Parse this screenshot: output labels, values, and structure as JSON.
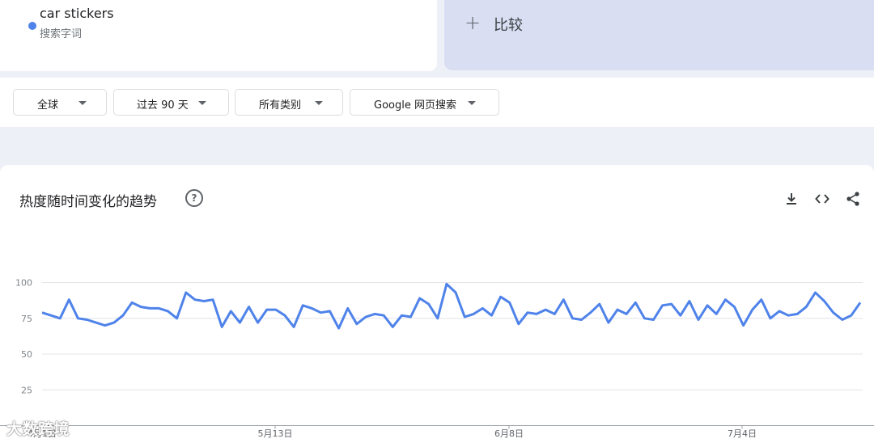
{
  "search_term": {
    "name": "car stickers",
    "type_label": "搜索字词",
    "color": "#4f83ea"
  },
  "compare": {
    "icon": "plus-icon",
    "label": "比较"
  },
  "filters": [
    {
      "label": "全球"
    },
    {
      "label": "过去 90 天"
    },
    {
      "label": "所有类别"
    },
    {
      "label": "Google 网页搜索"
    }
  ],
  "chart_section": {
    "title": "热度随时间变化的趋势",
    "help_icon": "help-circle-icon",
    "toolbar_icons": [
      "download-icon",
      "embed-code-icon",
      "share-icon"
    ]
  },
  "watermark": "大数跨境",
  "chart_data": {
    "type": "line",
    "x_tick_labels": [
      "4月1日",
      "5月13日",
      "6月8日",
      "7月4日"
    ],
    "y_ticks": [
      25,
      50,
      75,
      100
    ],
    "ylim": [
      0,
      100
    ],
    "grid": true,
    "series": [
      {
        "color": "#4f83ea",
        "values": [
          79,
          77,
          75,
          88,
          75,
          74,
          72,
          70,
          72,
          77,
          86,
          83,
          82,
          82,
          80,
          75,
          93,
          88,
          87,
          88,
          69,
          80,
          72,
          83,
          72,
          81,
          81,
          77,
          69,
          84,
          82,
          79,
          80,
          68,
          82,
          71,
          76,
          78,
          77,
          69,
          77,
          76,
          89,
          85,
          75,
          99,
          93,
          76,
          78,
          82,
          77,
          90,
          86,
          71,
          79,
          78,
          81,
          78,
          88,
          75,
          74,
          79,
          85,
          72,
          81,
          78,
          86,
          75,
          74,
          84,
          85,
          77,
          87,
          74,
          84,
          78,
          88,
          83,
          70,
          81,
          88,
          75,
          80,
          77,
          78,
          83,
          93,
          87,
          79,
          74,
          77,
          86
        ]
      }
    ]
  }
}
